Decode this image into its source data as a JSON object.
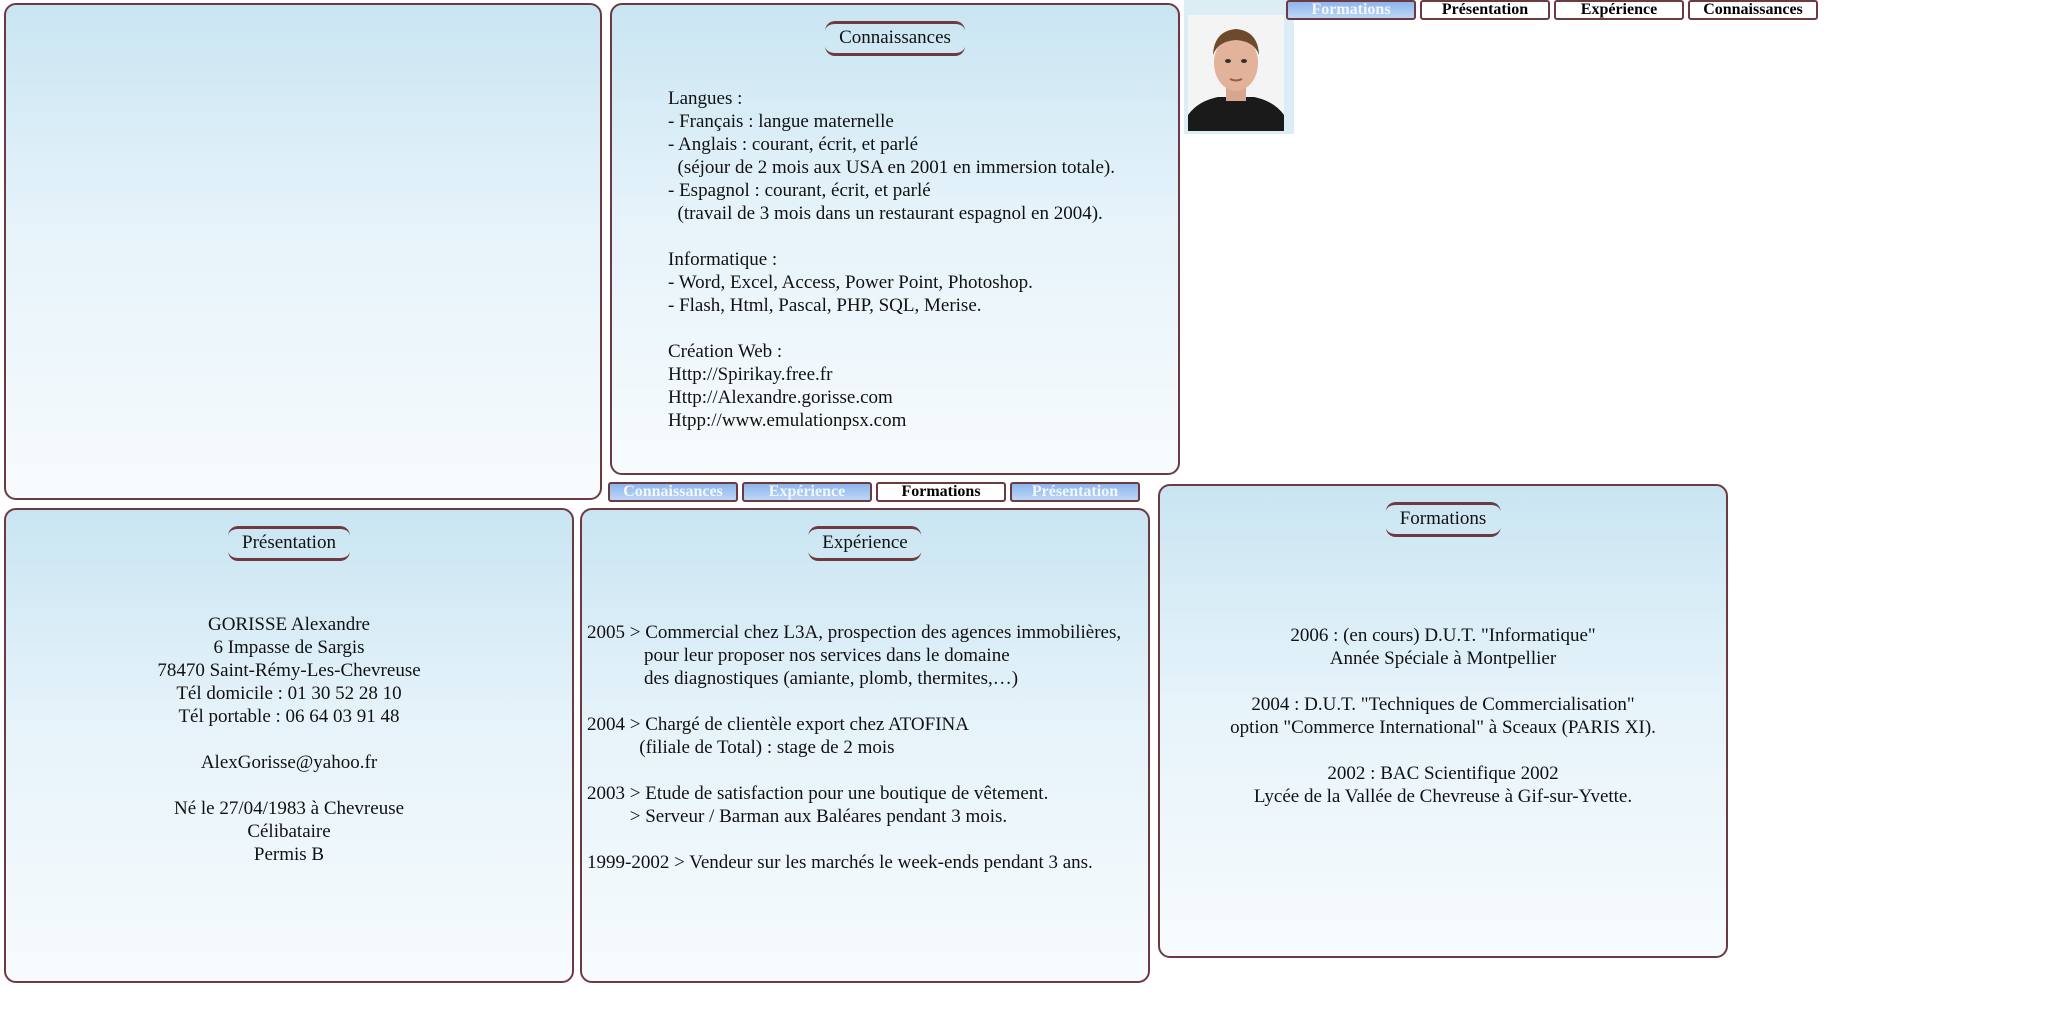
{
  "tabs_top": [
    "Formations",
    "Présentation",
    "Expérience",
    "Connaissances"
  ],
  "tabs_middle": [
    "Connaissances",
    "Expérience",
    "Formations",
    "Présentation"
  ],
  "connaissances": {
    "title": "Connaissances",
    "lines": [
      "Langues :",
      "- Français : langue maternelle",
      "- Anglais : courant, écrit, et parlé",
      "  (séjour de 2 mois aux USA en 2001 en immersion totale).",
      "- Espagnol : courant, écrit, et parlé",
      "  (travail de 3 mois dans un restaurant espagnol en 2004).",
      "",
      "Informatique :",
      "- Word, Excel, Access, Power Point, Photoshop.",
      "- Flash, Html, Pascal, PHP, SQL, Merise.",
      "",
      "Création Web :",
      "Http://Spirikay.free.fr",
      "Http://Alexandre.gorisse.com",
      "Htpp://www.emulationpsx.com"
    ]
  },
  "presentation": {
    "title": "Présentation",
    "lines": [
      "GORISSE Alexandre",
      "6 Impasse de Sargis",
      "78470 Saint-Rémy-Les-Chevreuse",
      "Tél domicile : 01 30 52 28 10",
      "Tél portable : 06 64 03 91 48",
      "",
      "AlexGorisse@yahoo.fr",
      "",
      "Né le 27/04/1983 à Chevreuse",
      "Célibataire",
      "Permis B"
    ]
  },
  "experience": {
    "title": "Expérience",
    "lines": [
      "2005 > Commercial chez L3A, prospection des agences immobilières,",
      "            pour leur proposer nos services dans le domaine",
      "            des diagnostiques (amiante, plomb, thermites,…)",
      "",
      "2004 > Chargé de clientèle export chez ATOFINA",
      "           (filiale de Total) : stage de 2 mois",
      "",
      "2003 > Etude de satisfaction pour une boutique de vêtement.",
      "         > Serveur / Barman aux Baléares pendant 3 mois.",
      "",
      "1999-2002 > Vendeur sur les marchés le week-ends pendant 3 ans."
    ]
  },
  "formations": {
    "title": "Formations",
    "lines": [
      "2006 : (en cours) D.U.T. \"Informatique\"",
      "Année Spéciale à Montpellier",
      "",
      "2004 : D.U.T. \"Techniques de Commercialisation\"",
      "option \"Commerce International\" à Sceaux (PARIS XI).",
      "",
      "2002 : BAC Scientifique 2002",
      "Lycée de la Vallée de Chevreuse à Gif-sur-Yvette."
    ]
  }
}
